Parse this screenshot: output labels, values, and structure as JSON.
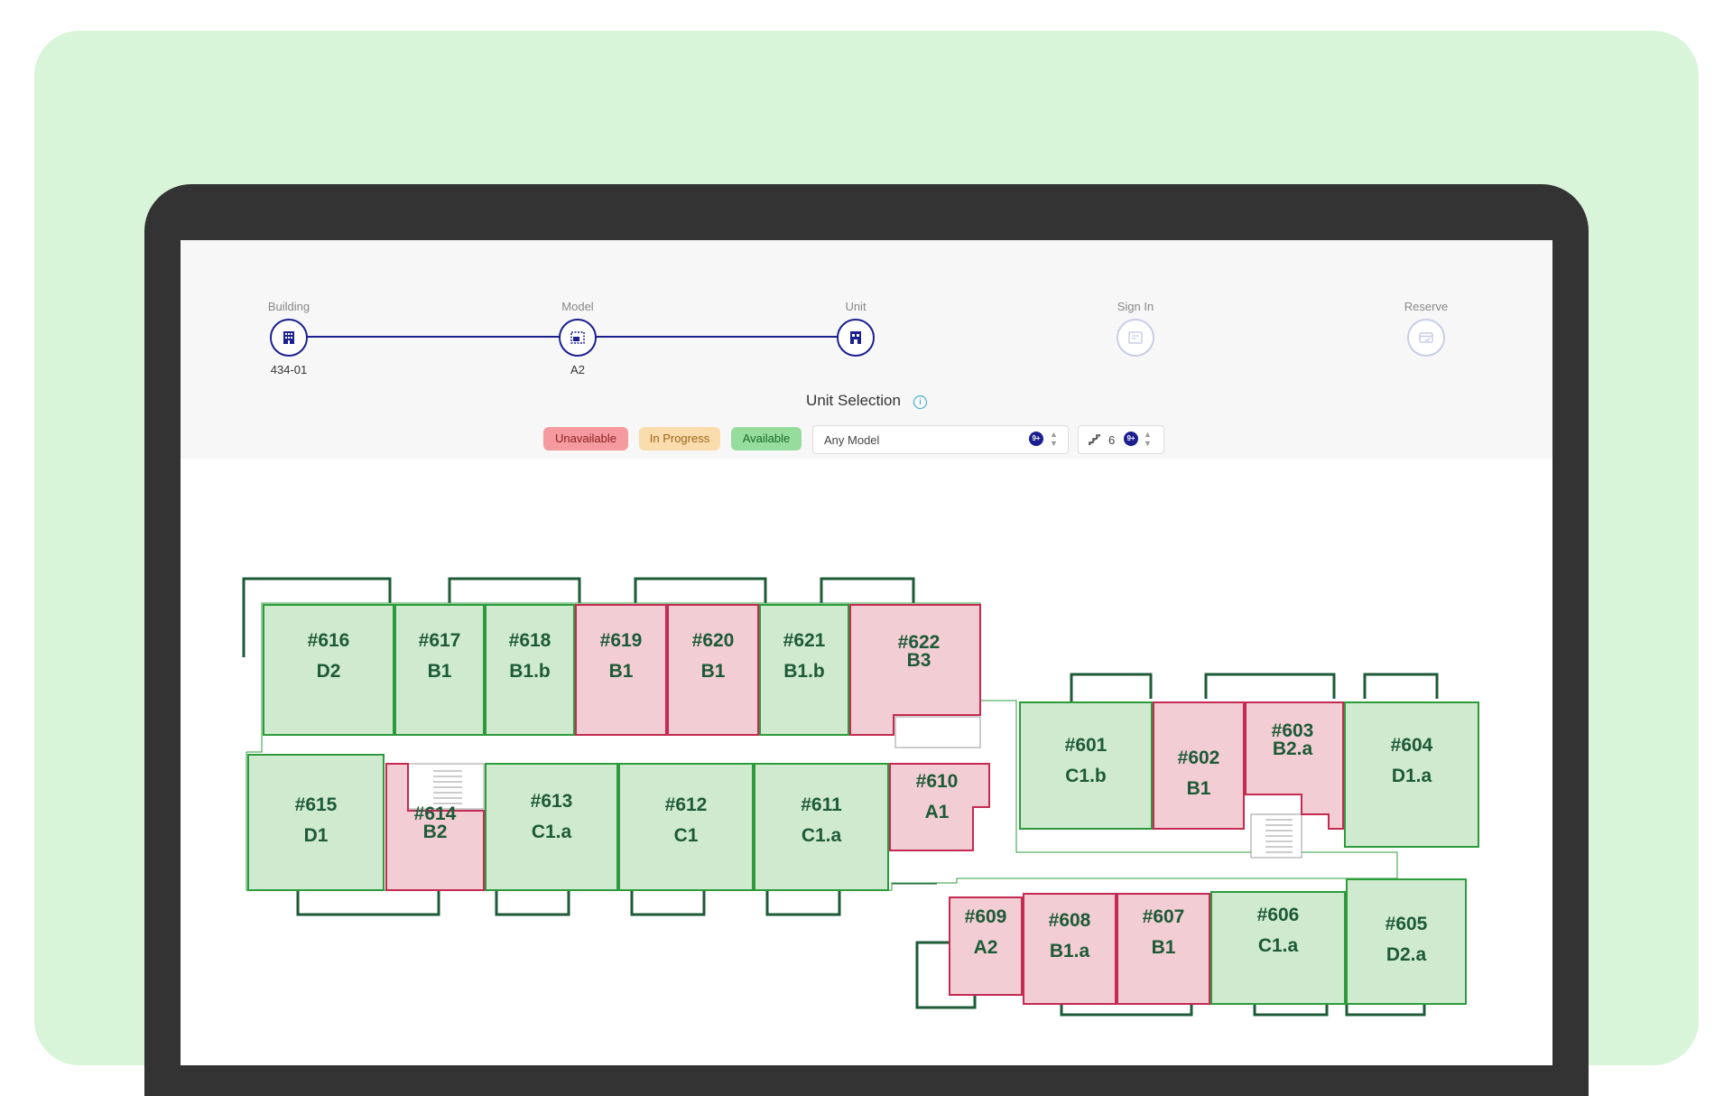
{
  "steps": [
    {
      "title": "Building",
      "value": "434-01",
      "active": true,
      "icon": "building-icon"
    },
    {
      "title": "Model",
      "value": "A2",
      "active": true,
      "icon": "floorplan-icon"
    },
    {
      "title": "Unit",
      "value": "",
      "active": true,
      "icon": "apartment-icon"
    },
    {
      "title": "Sign In",
      "value": "",
      "active": false,
      "icon": "signin-form-icon"
    },
    {
      "title": "Reserve",
      "value": "",
      "active": false,
      "icon": "payment-card-icon"
    }
  ],
  "section": {
    "title": "Unit Selection",
    "info_icon": "info-icon"
  },
  "legend": {
    "unavailable": "Unavailable",
    "in_progress": "In Progress",
    "available": "Available"
  },
  "filters": {
    "model_value": "Any Model",
    "model_badge": "9+",
    "floor_value": "6",
    "floor_badge": "9+",
    "floor_icon": "stairs-icon"
  },
  "colors": {
    "accent": "#1b1f8f",
    "unavailable_fill": "#f2cdd3",
    "unavailable_stroke": "#c42a52",
    "available_fill": "#d0ead0",
    "available_stroke": "#2d9b3c",
    "wall": "#1d5a37",
    "background": "#d8f5da"
  },
  "units": [
    {
      "id": "u616",
      "number": "#616",
      "model": "D2",
      "status": "available"
    },
    {
      "id": "u617",
      "number": "#617",
      "model": "B1",
      "status": "available"
    },
    {
      "id": "u618",
      "number": "#618",
      "model": "B1.b",
      "status": "available"
    },
    {
      "id": "u619",
      "number": "#619",
      "model": "B1",
      "status": "unavailable"
    },
    {
      "id": "u620",
      "number": "#620",
      "model": "B1",
      "status": "unavailable"
    },
    {
      "id": "u621",
      "number": "#621",
      "model": "B1.b",
      "status": "available"
    },
    {
      "id": "u622",
      "number": "#622",
      "model": "B3",
      "status": "unavailable"
    },
    {
      "id": "u615",
      "number": "#615",
      "model": "D1",
      "status": "available"
    },
    {
      "id": "u614",
      "number": "#614",
      "model": "B2",
      "status": "unavailable"
    },
    {
      "id": "u613",
      "number": "#613",
      "model": "C1.a",
      "status": "available"
    },
    {
      "id": "u612",
      "number": "#612",
      "model": "C1",
      "status": "available"
    },
    {
      "id": "u611",
      "number": "#611",
      "model": "C1.a",
      "status": "available"
    },
    {
      "id": "u610",
      "number": "#610",
      "model": "A1",
      "status": "unavailable"
    },
    {
      "id": "u601",
      "number": "#601",
      "model": "C1.b",
      "status": "available"
    },
    {
      "id": "u602",
      "number": "#602",
      "model": "B1",
      "status": "unavailable"
    },
    {
      "id": "u603",
      "number": "#603",
      "model": "B2.a",
      "status": "unavailable"
    },
    {
      "id": "u604",
      "number": "#604",
      "model": "D1.a",
      "status": "available"
    },
    {
      "id": "u609",
      "number": "#609",
      "model": "A2",
      "status": "unavailable"
    },
    {
      "id": "u608",
      "number": "#608",
      "model": "B1.a",
      "status": "unavailable"
    },
    {
      "id": "u607",
      "number": "#607",
      "model": "B1",
      "status": "unavailable"
    },
    {
      "id": "u606",
      "number": "#606",
      "model": "C1.a",
      "status": "available"
    },
    {
      "id": "u605",
      "number": "#605",
      "model": "D2.a",
      "status": "available"
    }
  ]
}
